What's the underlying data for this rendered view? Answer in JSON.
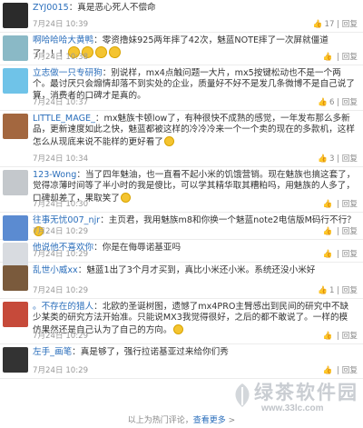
{
  "comments": [
    {
      "name": "ZYJ0015",
      "text": "：真是恶心死人不偿命",
      "time": "7月24日 10:39",
      "likes": "17",
      "h": 36,
      "avatar_bg": "#2b2b2b",
      "emojis": 0
    },
    {
      "name": "啊哈哈哈大黄鸭",
      "text": "：零资撸妹925两年摔了42次，魅蓝NOTE摔了一次屏就僵道了！！！",
      "time": "7月24日 10:38",
      "likes": "",
      "h": 36,
      "avatar_bg": "#8ab9c6",
      "emojis": 4
    },
    {
      "name": "立志做一只专研狗",
      "text": "：别说样，mx4点触问题一大片，mx5按键松动也不是一个两个。最讨厌只会煽情却落不到实处的企业，质量好不好不是发几条微博不是自己说了算，消费者的口碑才是真的。",
      "time": "7月24日 10:37",
      "likes": "6",
      "h": 50,
      "avatar_bg": "#6fc3e8",
      "emojis": 0
    },
    {
      "name": "LITTLE_MAGE_",
      "text": "：mx魅族卡顿low了，有种很快不成熟的感觉，一年发布那么多新品，更新速度如此之快，魅蓝都被这样的冷冷冷来一个一个卖的现在的多款机，这样怎么从现底来说不能样的更好看了",
      "time": "7月24日 10:34",
      "likes": "3",
      "h": 62,
      "avatar_bg": "#a3673f",
      "emojis": 1
    },
    {
      "name": "123-Wong",
      "text": "：当了四年魅油，也一直看不起小米的饥饿营销。现在魅族也搞这套了，觉得凉薄时间等了半小时的我是傻比，可以学其精华取其糟粕吗，用魅族的人多了，口碑却差了，果取笑了",
      "time": "7月24日 10:30",
      "likes": "",
      "h": 50,
      "avatar_bg": "#c4c8cc",
      "emojis": 1
    },
    {
      "name": "往事无忧007_njr",
      "text": "：主页君，我用魅族m8和你换一个魅蓝note2电信版M码行不行？",
      "time": "7月24日 10:29",
      "likes": "",
      "h": 30,
      "avatar_bg": "#5b8bd1",
      "emojis": 1
    },
    {
      "name": "他说他不喜欢你",
      "text": "：你是在侮辱诺基亚吗",
      "time": "7月24日 10:29",
      "likes": "",
      "h": 25,
      "avatar_bg": "#d8dbe0",
      "emojis": 0
    },
    {
      "name": "乱世小威xx",
      "text": "：魅蓝1出了3个月才买到，真比小米还小米。系统还没小米好",
      "time": "7月24日 10:29",
      "likes": "1",
      "h": 40,
      "avatar_bg": "#7a5a3c",
      "emojis": 0
    },
    {
      "name": "。不存在的猎人",
      "text": "：北欧的圣诞树图，遗憾了mx4PRO主臂感出到民间的研究中不缺少某类的研究方法开始准。只能说MX3我觉得很好，之后的都不敢说了。一样的模仿果然还是自己认为了自己的方向。",
      "time": "7月24日 10:29",
      "likes": "",
      "h": 50,
      "avatar_bg": "#c64a3a",
      "emojis": 1
    },
    {
      "name": "左手_画笔",
      "text": "：真是够了，强行拉诺基亚过来给你们秀",
      "time": "7月24日 10:29",
      "likes": "",
      "h": 38,
      "avatar_bg": "#333333",
      "emojis": 0
    }
  ],
  "reply_label": "回复",
  "footer": {
    "prefix": "以上为热门评论，",
    "link": "查看更多",
    "suffix": " >"
  },
  "watermark": {
    "title": "绿茶软件园",
    "url": "www.33lc.com"
  }
}
